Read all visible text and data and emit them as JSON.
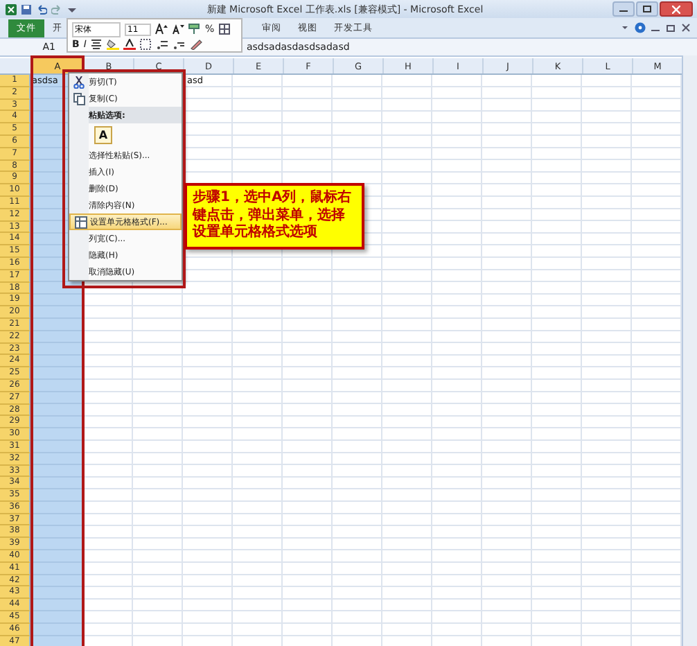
{
  "window": {
    "title": "新建 Microsoft Excel 工作表.xls [兼容模式] - Microsoft Excel"
  },
  "ribbon_tabs": [
    {
      "label": "文件",
      "kind": "file"
    },
    {
      "label": "开",
      "kind": "tab"
    },
    {
      "label": "审阅",
      "kind": "tab"
    },
    {
      "label": "视图",
      "kind": "tab"
    },
    {
      "label": "开发工具",
      "kind": "tab"
    }
  ],
  "formula_bar": {
    "name_box": "A1",
    "content": "asdsadasdasdsadasd"
  },
  "mini_toolbar": {
    "font": "宋体",
    "size": "11",
    "percent": "%",
    "bold": "B",
    "italic": "I"
  },
  "sheet": {
    "columns": [
      {
        "label": "A",
        "selected": true
      },
      {
        "label": "B",
        "selected": false
      },
      {
        "label": "C",
        "selected": false
      },
      {
        "label": "D",
        "selected": false
      },
      {
        "label": "E",
        "selected": false
      },
      {
        "label": "F",
        "selected": false
      },
      {
        "label": "G",
        "selected": false
      },
      {
        "label": "H",
        "selected": false
      },
      {
        "label": "I",
        "selected": false
      },
      {
        "label": "J",
        "selected": false
      },
      {
        "label": "K",
        "selected": false
      },
      {
        "label": "L",
        "selected": false
      },
      {
        "label": "M",
        "selected": false
      }
    ],
    "first_row": {
      "column_a": "asdsa",
      "column_d": "asd"
    },
    "row_headers": [
      "1",
      "2",
      "3",
      "4",
      "5",
      "6",
      "7",
      "8",
      "9",
      "10",
      "11",
      "12",
      "13",
      "14",
      "15",
      "16",
      "17",
      "18",
      "19",
      "20",
      "21",
      "22",
      "23",
      "24",
      "25",
      "26",
      "27",
      "28",
      "29",
      "30",
      "31",
      "32",
      "33",
      "34",
      "35",
      "36",
      "37",
      "38",
      "39",
      "40",
      "41",
      "42",
      "43",
      "44",
      "45",
      "46",
      "47"
    ]
  },
  "context_menu": [
    {
      "label": "剪切(T)",
      "kind": "cut",
      "selected": false
    },
    {
      "label": "复制(C)",
      "kind": "copy",
      "selected": false
    },
    {
      "label": "粘贴选项:",
      "kind": "paste-header",
      "selected": false
    },
    {
      "label": "A",
      "kind": "paste-button",
      "selected": false
    },
    {
      "label": "选择性粘贴(S)...",
      "kind": "plain",
      "selected": false
    },
    {
      "label": "插入(I)",
      "kind": "plain",
      "selected": false
    },
    {
      "label": "删除(D)",
      "kind": "plain",
      "selected": false
    },
    {
      "label": "清除内容(N)",
      "kind": "plain",
      "selected": false
    },
    {
      "label": "设置单元格格式(F)...",
      "kind": "format",
      "selected": true
    },
    {
      "label": "列宽(C)...",
      "kind": "plain",
      "selected": false
    },
    {
      "label": "隐藏(H)",
      "kind": "plain",
      "selected": false
    },
    {
      "label": "取消隐藏(U)",
      "kind": "plain",
      "selected": false
    }
  ],
  "callout": {
    "text": "步骤1，选中A列，鼠标右键点击，弹出菜单，选择设置单元格格式选项"
  }
}
